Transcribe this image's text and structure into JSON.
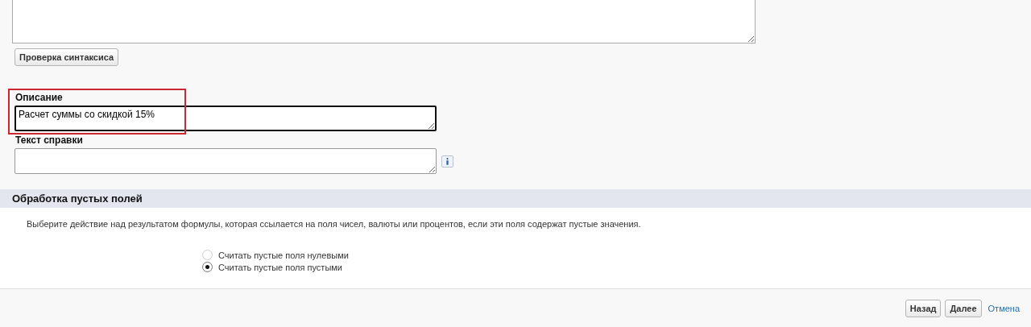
{
  "check_syntax_button": "Проверка синтаксиса",
  "description": {
    "label": "Описание",
    "value": "Расчет суммы со скидкой 15%",
    "focused": true,
    "highlighted": true
  },
  "help_text": {
    "label": "Текст справки"
  },
  "blank_handling": {
    "title": "Обработка пустых полей",
    "instructions": "Выберите действие над результатом формулы, которая ссылается на поля чисел, валюты или процентов, если эти поля содержат пустые значения.",
    "options": [
      {
        "label": "Считать пустые поля нулевыми",
        "selected": false
      },
      {
        "label": "Считать пустые поля пустыми",
        "selected": true
      }
    ]
  },
  "footer": {
    "buttons": [
      {
        "label": "Назад",
        "kind": "button"
      },
      {
        "label": "Далее",
        "kind": "button"
      },
      {
        "label": "Отмена",
        "kind": "link"
      }
    ]
  }
}
